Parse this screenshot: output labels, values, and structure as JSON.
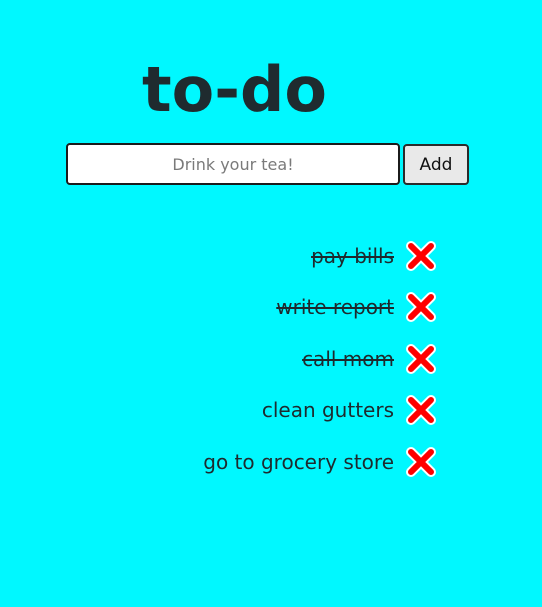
{
  "app": {
    "title": "to-do"
  },
  "form": {
    "placeholder": "Drink your tea!",
    "value": "",
    "add_label": "Add"
  },
  "todos": [
    {
      "label": "pay bills",
      "completed": true
    },
    {
      "label": "write report",
      "completed": true
    },
    {
      "label": "call mom",
      "completed": true
    },
    {
      "label": "clean gutters",
      "completed": false
    },
    {
      "label": "go to grocery store",
      "completed": false
    }
  ],
  "icons": {
    "delete": "close-x-icon"
  },
  "colors": {
    "background": "#00f8ff",
    "text": "#1e2a2e",
    "delete_red": "#ff0000"
  }
}
